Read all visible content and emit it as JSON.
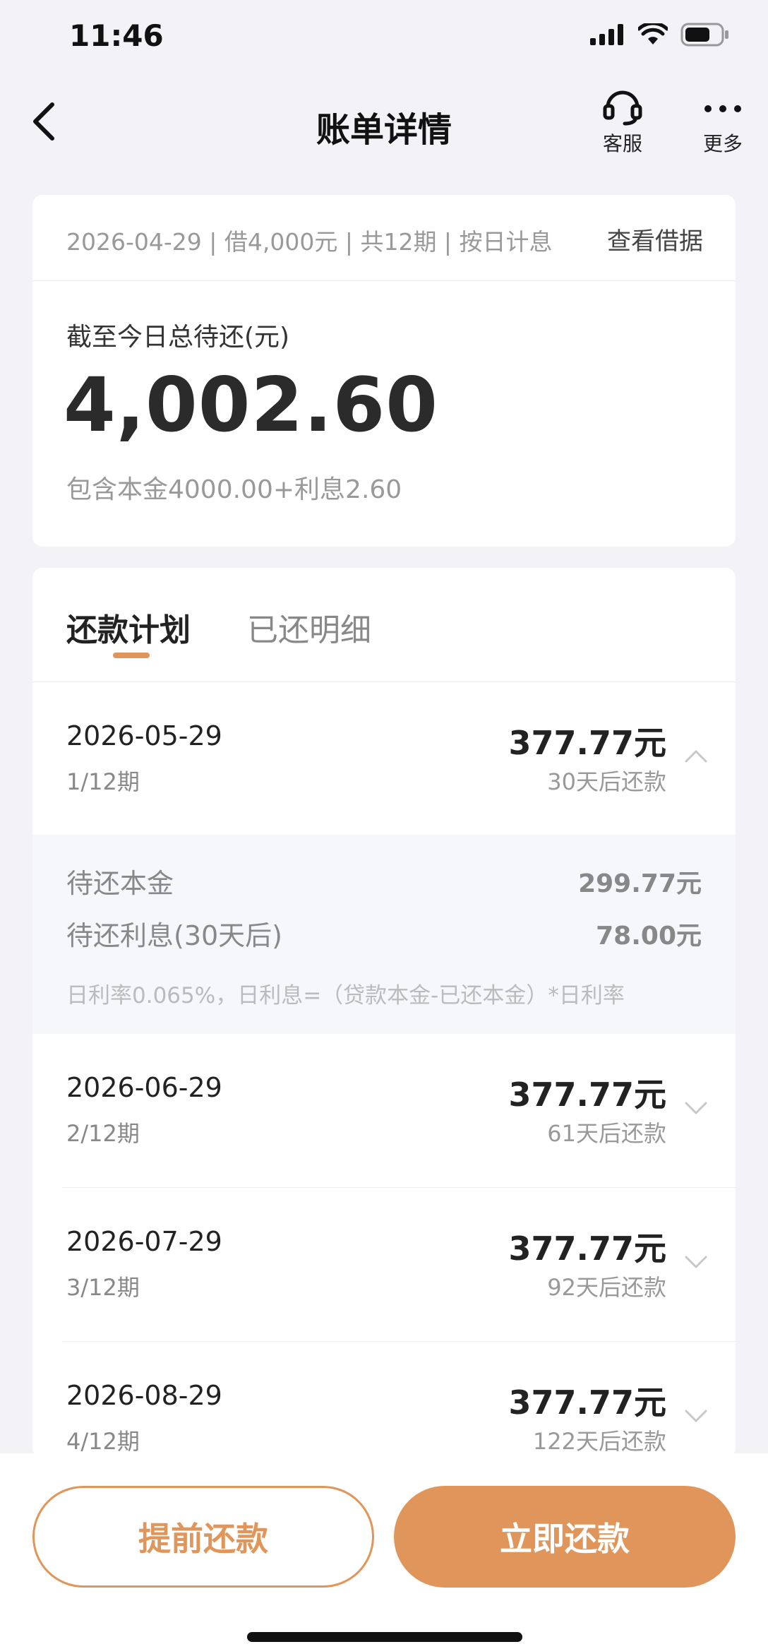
{
  "status": {
    "time": "11:46",
    "icons": [
      "cellular-signal-icon",
      "wifi-icon",
      "battery-icon"
    ]
  },
  "nav": {
    "title": "账单详情",
    "service_label": "客服",
    "more_label": "更多",
    "icons": [
      "back-chevron-icon",
      "headset-icon",
      "more-dots-icon"
    ]
  },
  "summary": {
    "meta": "2026-04-29 | 借4,000元 | 共12期 | 按日计息",
    "view_loan_label": "查看借据",
    "due_label": "截至今日总待还(元)",
    "due_amount": "4,002.60",
    "breakdown": "包含本金4000.00+利息2.60"
  },
  "plan": {
    "tabs": [
      "还款计划",
      "已还明细"
    ],
    "active_tab": 0,
    "items": [
      {
        "date": "2026-05-29",
        "term": "1/12期",
        "amount": "377.77元",
        "due_in": "30天后还款",
        "expanded": true,
        "detail": {
          "principal_label": "待还本金",
          "principal_value": "299.77元",
          "interest_label": "待还利息(30天后)",
          "interest_value": "78.00元",
          "note": "日利率0.065%，日利息=（贷款本金-已还本金）*日利率"
        }
      },
      {
        "date": "2026-06-29",
        "term": "2/12期",
        "amount": "377.77元",
        "due_in": "61天后还款",
        "expanded": false
      },
      {
        "date": "2026-07-29",
        "term": "3/12期",
        "amount": "377.77元",
        "due_in": "92天后还款",
        "expanded": false
      },
      {
        "date": "2026-08-29",
        "term": "4/12期",
        "amount": "377.77元",
        "due_in": "122天后还款",
        "expanded": false
      }
    ]
  },
  "actions": {
    "prepay_label": "提前还款",
    "pay_label": "立即还款"
  },
  "colors": {
    "accent": "#e0965a",
    "background": "#f2f2f7",
    "detail_background": "#f6f7fb"
  }
}
